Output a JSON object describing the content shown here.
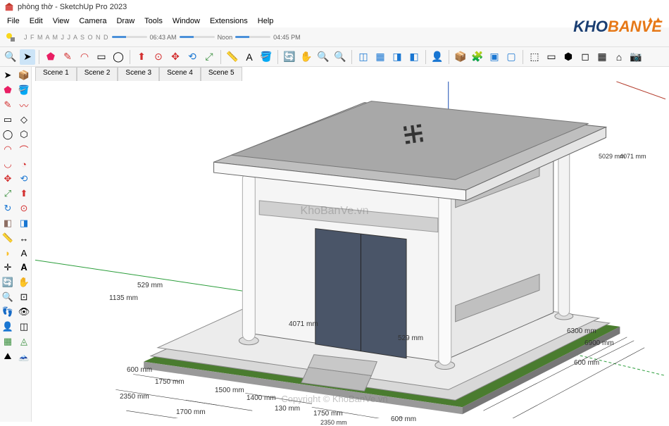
{
  "window": {
    "title": "phòng thờ - SketchUp Pro 2023"
  },
  "menu": {
    "file": "File",
    "edit": "Edit",
    "view": "View",
    "camera": "Camera",
    "draw": "Draw",
    "tools": "Tools",
    "window": "Window",
    "extensions": "Extensions",
    "help": "Help"
  },
  "shadow": {
    "months": "J F M A M J J A S O N D",
    "time1": "06:43 AM",
    "noon": "Noon",
    "time2": "04:45 PM"
  },
  "scenes": {
    "s1": "Scene 1",
    "s2": "Scene 2",
    "s3": "Scene 3",
    "s4": "Scene 4",
    "s5": "Scene 5"
  },
  "logo": {
    "text1": "KHO",
    "text2": "BANVE"
  },
  "watermark": {
    "center": "KhoBanVe.vn",
    "bottom": "Copyright © KhoBanVe.vn"
  },
  "dims": {
    "d600a": "600 mm",
    "d1750a": "1750 mm",
    "d2350": "2350 mm",
    "d1500": "1500 mm",
    "d1400": "1400 mm",
    "d1700": "1700 mm",
    "d130": "130 mm",
    "d1750b": "1750 mm",
    "d600b": "600 mm",
    "d2350b": "2350 mm",
    "d600c": "600 mm",
    "d6300": "6300 mm",
    "d6900": "6900 mm",
    "d1135": "1135 mm",
    "d529a": "529 mm",
    "d529b": "529 mm",
    "d4071a": "4071 mm",
    "d4071b": "4071 mm",
    "d5029": "5029 mm"
  }
}
